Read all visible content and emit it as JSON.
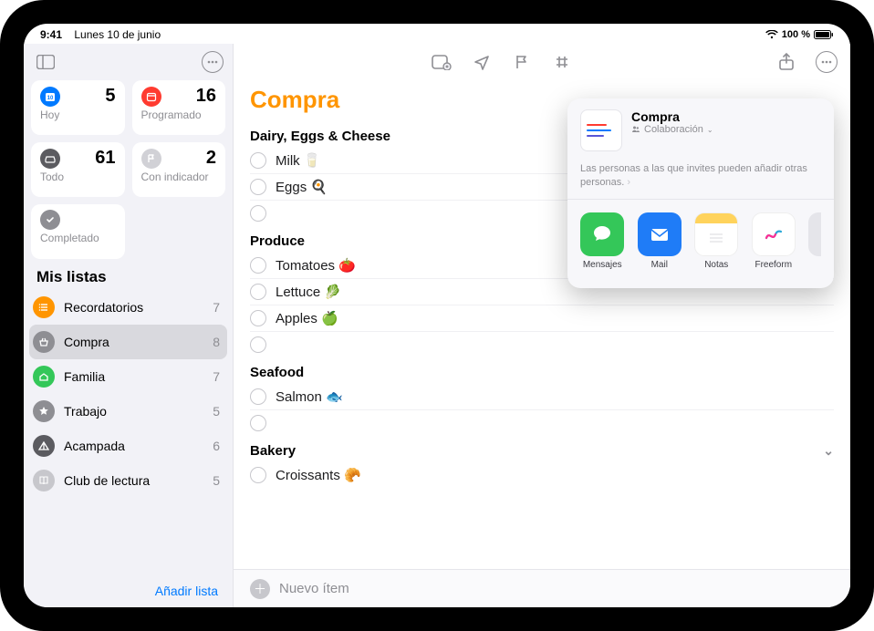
{
  "status": {
    "time": "9:41",
    "date": "Lunes 10 de junio",
    "battery_text": "100 %"
  },
  "sidebar": {
    "cards": [
      {
        "id": "today",
        "label": "Hoy",
        "count": 5
      },
      {
        "id": "scheduled",
        "label": "Programado",
        "count": 16
      },
      {
        "id": "all",
        "label": "Todo",
        "count": 61
      },
      {
        "id": "flagged",
        "label": "Con indicador",
        "count": 2
      },
      {
        "id": "completed",
        "label": "Completado",
        "count": null
      }
    ],
    "my_lists_title": "Mis listas",
    "lists": [
      {
        "name": "Recordatorios",
        "count": 7,
        "color": "li-orange",
        "icon": "list"
      },
      {
        "name": "Compra",
        "count": 8,
        "color": "li-gray",
        "icon": "basket",
        "selected": true
      },
      {
        "name": "Familia",
        "count": 7,
        "color": "li-green",
        "icon": "house"
      },
      {
        "name": "Trabajo",
        "count": 5,
        "color": "li-gray",
        "icon": "star"
      },
      {
        "name": "Acampada",
        "count": 6,
        "color": "li-dgray",
        "icon": "tent"
      },
      {
        "name": "Club de lectura",
        "count": 5,
        "color": "li-lgray",
        "icon": "book"
      }
    ],
    "add_list_label": "Añadir lista"
  },
  "main": {
    "title": "Compra",
    "new_item_placeholder": "Nuevo ítem",
    "groups": [
      {
        "name": "Dairy, Eggs & Cheese",
        "items": [
          "Milk 🥛",
          "Eggs 🍳"
        ],
        "trailing_empty": true
      },
      {
        "name": "Produce",
        "items": [
          "Tomatoes 🍅",
          "Lettuce 🥬",
          "Apples 🍏"
        ],
        "trailing_empty": true
      },
      {
        "name": "Seafood",
        "items": [
          "Salmon 🐟"
        ],
        "trailing_empty": true
      },
      {
        "name": "Bakery",
        "items": [
          "Croissants 🥐"
        ],
        "collapsed_chevron": true
      }
    ]
  },
  "share": {
    "title": "Compra",
    "subtitle": "Colaboración",
    "note": "Las personas a las que invites pueden añadir otras personas.",
    "apps": [
      {
        "name": "Mensajes",
        "key": "messages"
      },
      {
        "name": "Mail",
        "key": "mail"
      },
      {
        "name": "Notas",
        "key": "notes"
      },
      {
        "name": "Freeform",
        "key": "freeform"
      }
    ]
  }
}
